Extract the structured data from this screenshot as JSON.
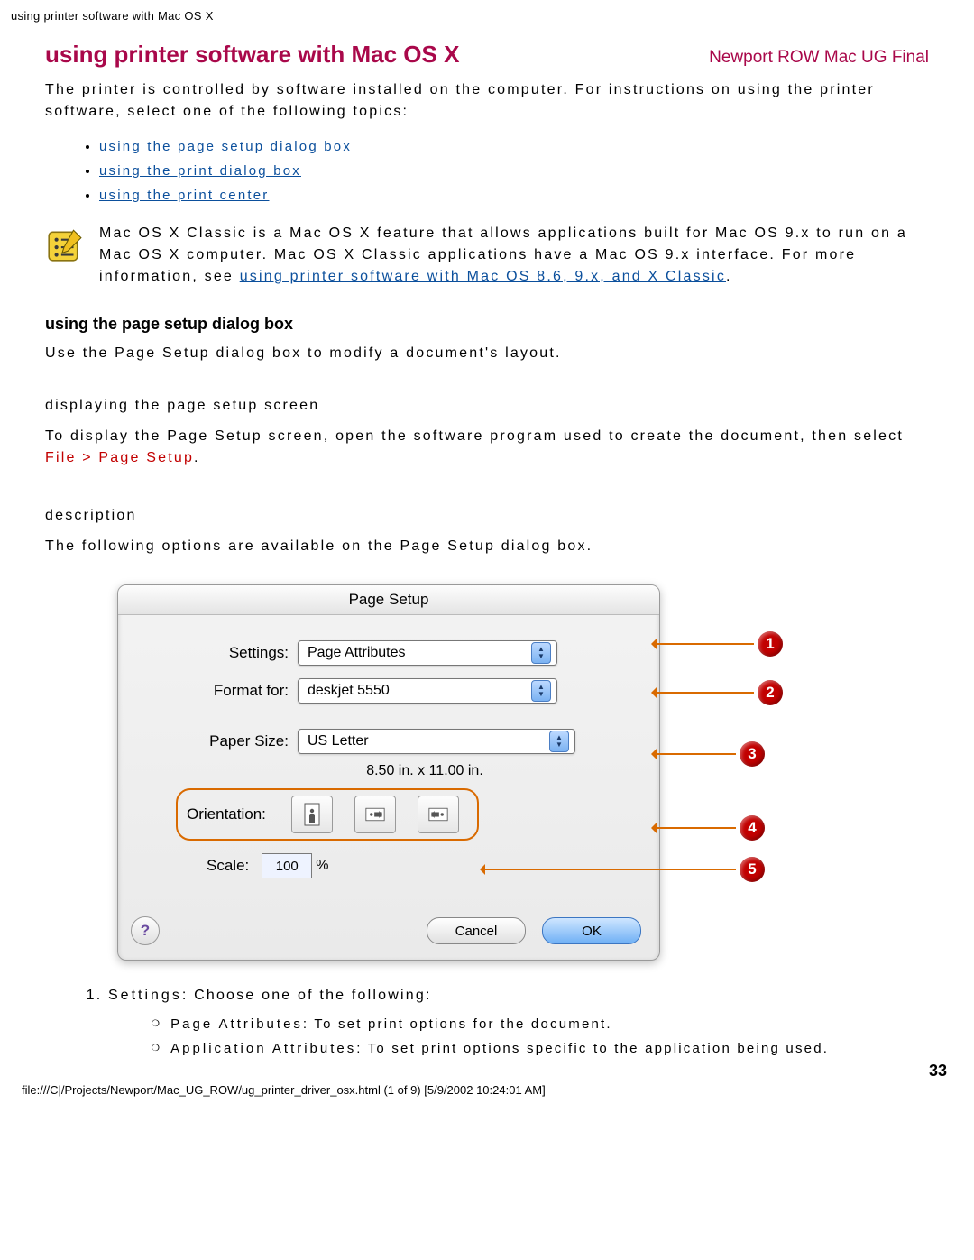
{
  "top_line": "using printer software with Mac OS X",
  "title": "using printer software with Mac OS X",
  "doc_tag": "Newport ROW Mac UG Final",
  "intro": "The printer is controlled by software installed on the computer. For instructions on using the printer software, select one of the following topics:",
  "links": [
    "using the page setup dialog box",
    "using the print dialog box",
    "using the print center"
  ],
  "note": {
    "prefix": "Mac OS X Classic is a Mac OS X feature that allows applications built for Mac OS 9.x to run on a Mac OS X computer. Mac OS X Classic applications have a Mac OS 9.x interface. For more information, see ",
    "link": "using printer software with Mac OS 8.6, 9.x, and X Classic",
    "suffix": "."
  },
  "sub_heading": "using the page setup dialog box",
  "sub_intro": "Use the Page Setup dialog box to modify a document's layout.",
  "display_heading": "displaying the page setup screen",
  "display_text_pre": "To display the Page Setup screen, open the software program used to create the document, then select ",
  "display_text_red": "File > Page Setup",
  "display_text_post": ".",
  "desc_heading": "description",
  "desc_intro": "The following options are available on the Page Setup dialog box.",
  "dialog": {
    "title": "Page Setup",
    "settings_label": "Settings:",
    "settings_value": "Page Attributes",
    "format_label": "Format for:",
    "format_value": "deskjet 5550",
    "paper_label": "Paper Size:",
    "paper_value": "US Letter",
    "paper_dim": "8.50 in. x 11.00 in.",
    "orient_label": "Orientation:",
    "scale_label": "Scale:",
    "scale_value": "100",
    "scale_suffix": "%",
    "help": "?",
    "cancel": "Cancel",
    "ok": "OK"
  },
  "callouts": [
    "1",
    "2",
    "3",
    "4",
    "5"
  ],
  "ordered": {
    "item1_pre": "Settings",
    "item1_post": ": Choose one of the following:",
    "sub1_pre": "Page Attributes",
    "sub1_post": ": To set print options for the document.",
    "sub2_pre": "Application Attributes",
    "sub2_post": ": To set print options specific to the application being used."
  },
  "page_num": "33",
  "footer": "file:///C|/Projects/Newport/Mac_UG_ROW/ug_printer_driver_osx.html (1 of 9) [5/9/2002 10:24:01 AM]"
}
